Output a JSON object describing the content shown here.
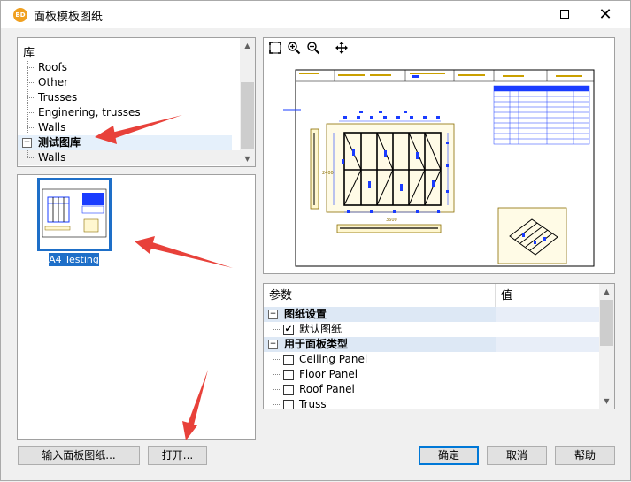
{
  "window": {
    "icon_text": "BD",
    "title": "面板模板图纸",
    "maximize_label": "",
    "close_label": "✕"
  },
  "library": {
    "header": "库",
    "items": [
      {
        "label": "Roofs",
        "level": 1
      },
      {
        "label": "Other",
        "level": 1
      },
      {
        "label": "Trusses",
        "level": 1
      },
      {
        "label": "Enginering, trusses",
        "level": 1
      },
      {
        "label": "Walls",
        "level": 1
      },
      {
        "label": "测试图库",
        "level": 0,
        "expander": "−",
        "selected": true
      },
      {
        "label": "Walls",
        "level": 1
      }
    ]
  },
  "thumbnails": {
    "selected_label": "A4 Testing"
  },
  "preview": {
    "tools": [
      "fit-icon",
      "zoom-in-icon",
      "zoom-out-icon",
      "pan-icon"
    ],
    "dimension_bottom": "3600",
    "dimension_left": "2400"
  },
  "params": {
    "col_param": "参数",
    "col_value": "值",
    "rows": [
      {
        "type": "category",
        "expander": "−",
        "label": "图纸设置"
      },
      {
        "type": "check",
        "checked": true,
        "label": "默认图纸"
      },
      {
        "type": "category",
        "expander": "−",
        "label": "用于面板类型"
      },
      {
        "type": "check",
        "checked": false,
        "label": "Ceiling Panel"
      },
      {
        "type": "check",
        "checked": false,
        "label": "Floor Panel"
      },
      {
        "type": "check",
        "checked": false,
        "label": "Roof Panel"
      },
      {
        "type": "check",
        "checked": false,
        "label": "Truss"
      }
    ]
  },
  "buttons": {
    "import": "输入面板图纸...",
    "open": "打开...",
    "ok": "确定",
    "cancel": "取消",
    "help": "帮助"
  },
  "colors": {
    "accent": "#1e6fc8",
    "annotation_arrow": "#e8413a"
  }
}
